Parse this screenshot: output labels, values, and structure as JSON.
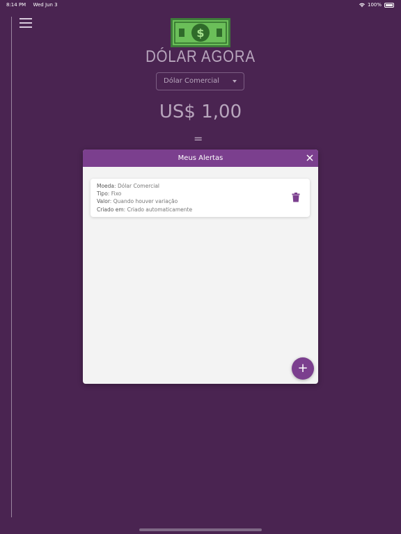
{
  "status_bar": {
    "time": "8:14 PM",
    "date": "Wed Jun 3",
    "battery": "100%"
  },
  "header": {
    "menu_icon": "hamburger-menu-icon",
    "logo_icon": "dollar-bill-icon",
    "logo_symbol": "$",
    "title": "DÓLAR AGORA"
  },
  "currency": {
    "selected": "Dólar Comercial"
  },
  "price": {
    "text": "US$ 1,00",
    "equals": "="
  },
  "modal": {
    "title": "Meus Alertas",
    "close_icon": "close-icon",
    "alert": {
      "moeda_label": "Moeda",
      "moeda_value": "Dólar Comercial",
      "tipo_label": "Tipo",
      "tipo_value": "Fixo",
      "valor_label": "Valor",
      "valor_value": "Quando houver variação",
      "criado_label": "Criado em",
      "criado_value": "Criado automaticamente",
      "delete_icon": "trash-icon"
    },
    "fab_label": "+"
  },
  "colors": {
    "background": "#4a2451",
    "accent": "#7b3f8e"
  }
}
